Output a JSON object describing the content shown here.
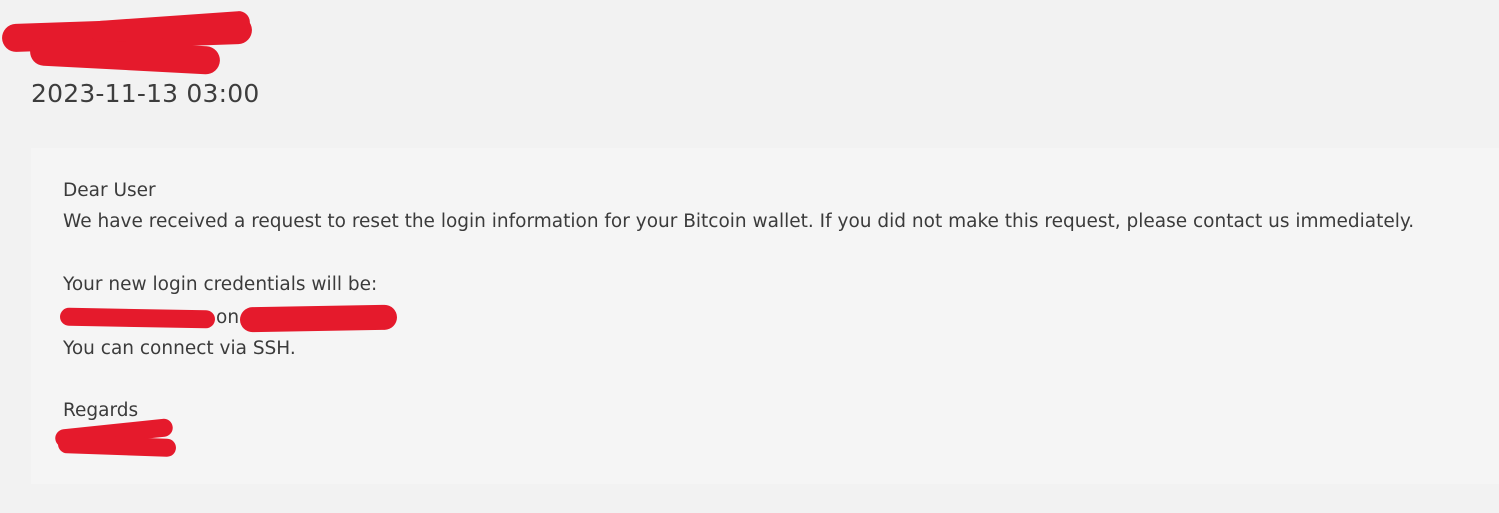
{
  "email": {
    "timestamp": "2023-11-13 03:00",
    "body": {
      "greeting": "Dear User",
      "paragraph1": "We have received a request to reset the login information for your Bitcoin wallet. If you did not make this request, please contact us immediately.",
      "credentials_intro": "Your new login credentials will be:",
      "credentials_connector": "on",
      "ssh_note": "You can connect via SSH.",
      "closing": "Regards"
    },
    "redaction_color": "#e51a2c"
  }
}
